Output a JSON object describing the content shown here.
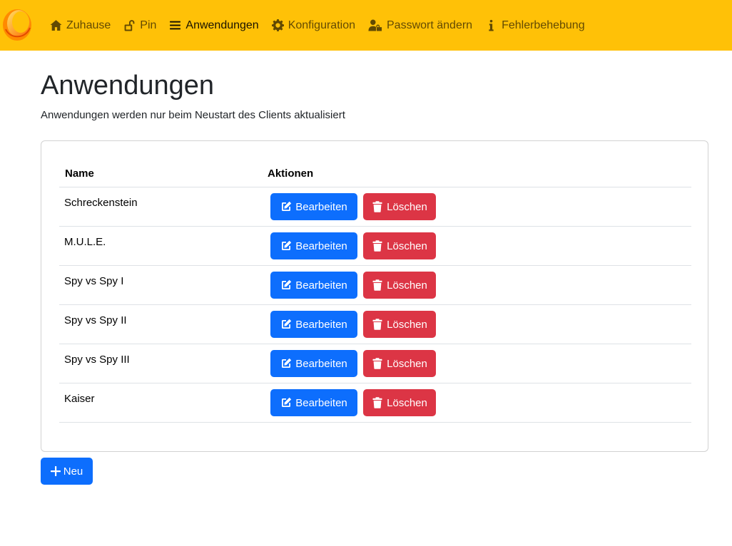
{
  "nav": {
    "items": [
      {
        "label": "Zuhause",
        "icon": "home-icon"
      },
      {
        "label": "Pin",
        "icon": "unlock-icon"
      },
      {
        "label": "Anwendungen",
        "icon": "list-icon"
      },
      {
        "label": "Konfiguration",
        "icon": "gear-icon"
      },
      {
        "label": "Passwort ändern",
        "icon": "user-lock-icon"
      },
      {
        "label": "Fehlerbehebung",
        "icon": "info-icon"
      }
    ],
    "active": "Anwendungen",
    "bg_color": "#ffc107"
  },
  "page": {
    "title": "Anwendungen",
    "subtitle": "Anwendungen werden nur beim Neustart des Clients aktualisiert"
  },
  "table": {
    "headers": {
      "name": "Name",
      "actions": "Aktionen"
    },
    "rows": [
      {
        "name": "Schreckenstein"
      },
      {
        "name": "M.U.L.E."
      },
      {
        "name": "Spy vs Spy I"
      },
      {
        "name": "Spy vs Spy II"
      },
      {
        "name": "Spy vs Spy III"
      },
      {
        "name": "Kaiser"
      }
    ],
    "edit_label": "Bearbeiten",
    "delete_label": "Löschen",
    "edit_color": "#0d6efd",
    "delete_color": "#dc3545"
  },
  "new_button": {
    "label": "Neu"
  }
}
